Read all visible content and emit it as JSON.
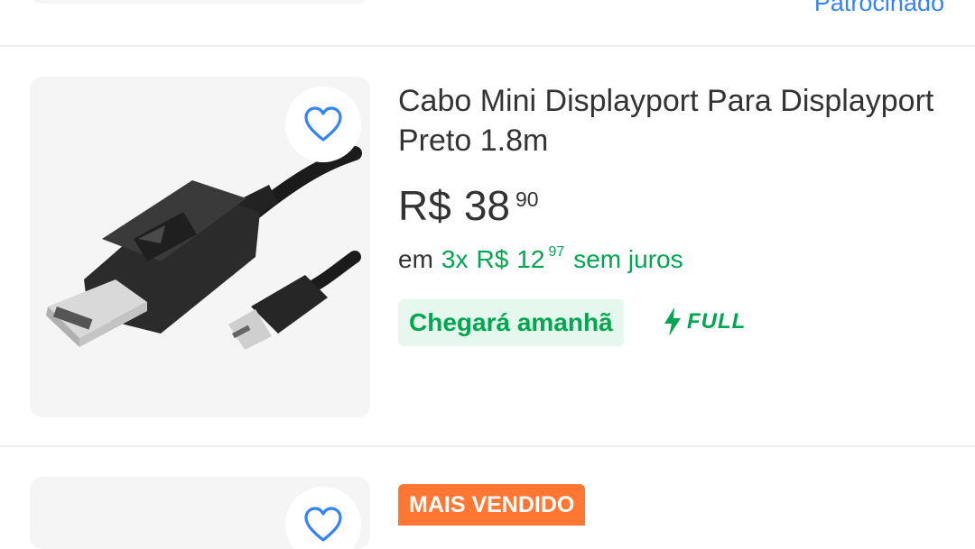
{
  "previous_item": {
    "sponsored_label": "Patrocinado"
  },
  "product": {
    "title": "Cabo Mini Displayport Para Displayport Preto 1.8m",
    "price": {
      "currency": "R$",
      "integer": "38",
      "cents": "90"
    },
    "installments": {
      "prefix": "em",
      "count": "3x",
      "currency": "R$",
      "integer": "12",
      "cents": "97",
      "suffix": "sem juros"
    },
    "delivery": "Chegará amanhã",
    "shipping_badge": "FULL",
    "favorite_icon": "heart-outline-icon"
  },
  "next_item": {
    "badge": "MAIS VENDIDO"
  },
  "colors": {
    "green": "#00a650",
    "blue": "#3483fa",
    "orange": "#ff7733",
    "thumb_bg": "#f5f5f5"
  }
}
